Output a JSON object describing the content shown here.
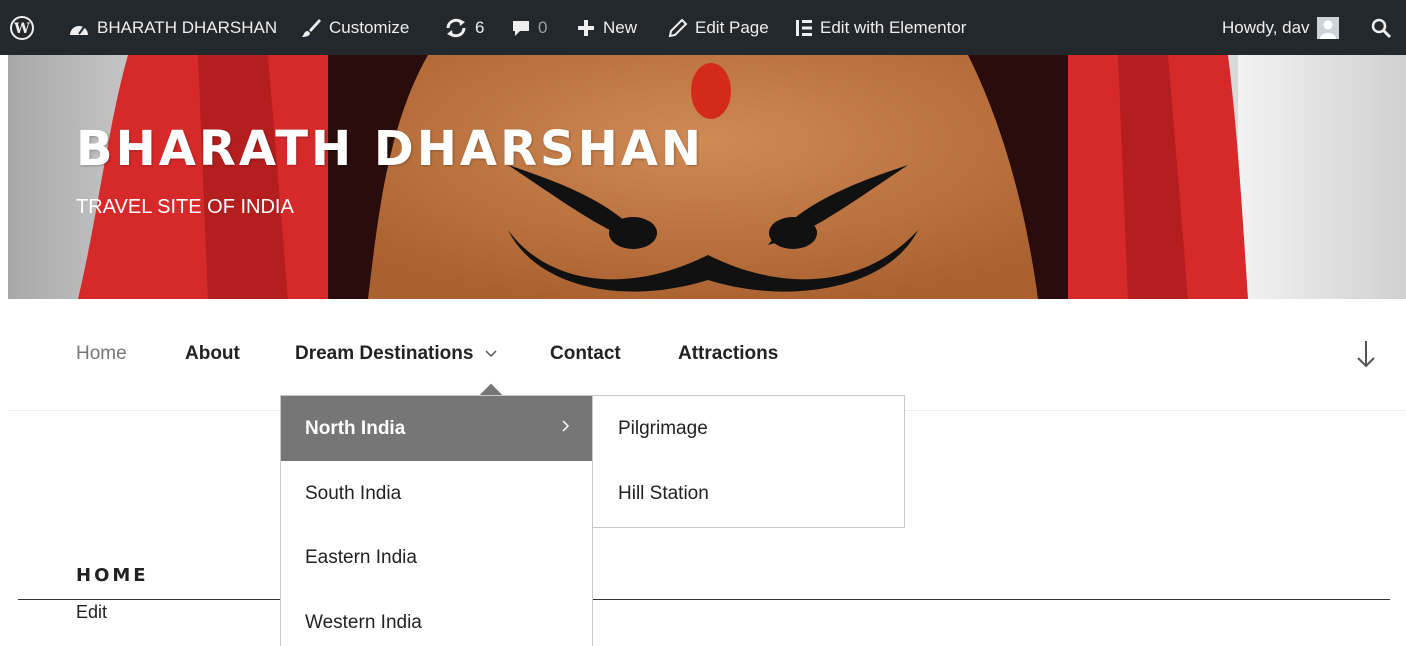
{
  "admin_bar": {
    "site_name": "BHARATH DHARSHAN",
    "customize": "Customize",
    "updates_count": "6",
    "comments_count": "0",
    "new": "New",
    "edit_page": "Edit Page",
    "edit_with_elementor": "Edit with Elementor",
    "howdy": "Howdy, dav"
  },
  "header": {
    "site_title": "BHARATH DHARSHAN",
    "site_description": "TRAVEL SITE OF INDIA"
  },
  "nav": {
    "items": [
      {
        "label": "Home",
        "current": true
      },
      {
        "label": "About"
      },
      {
        "label": "Dream Destinations",
        "has_submenu": true
      },
      {
        "label": "Contact"
      },
      {
        "label": "Attractions"
      }
    ],
    "scroll_icon": "arrow-down-icon"
  },
  "dropdown": {
    "items": [
      {
        "label": "North India",
        "active": true
      },
      {
        "label": "South India"
      },
      {
        "label": "Eastern India"
      },
      {
        "label": "Western India"
      }
    ],
    "submenu": [
      {
        "label": "Pilgrimage"
      },
      {
        "label": "Hill Station"
      }
    ]
  },
  "content": {
    "page_title": "HOME",
    "edit_link": "Edit"
  },
  "colors": {
    "admin_bar_bg": "#23282d",
    "active_menu_bg": "#767676",
    "header_red": "#d62a2a",
    "face_skin": "#c47a45"
  }
}
